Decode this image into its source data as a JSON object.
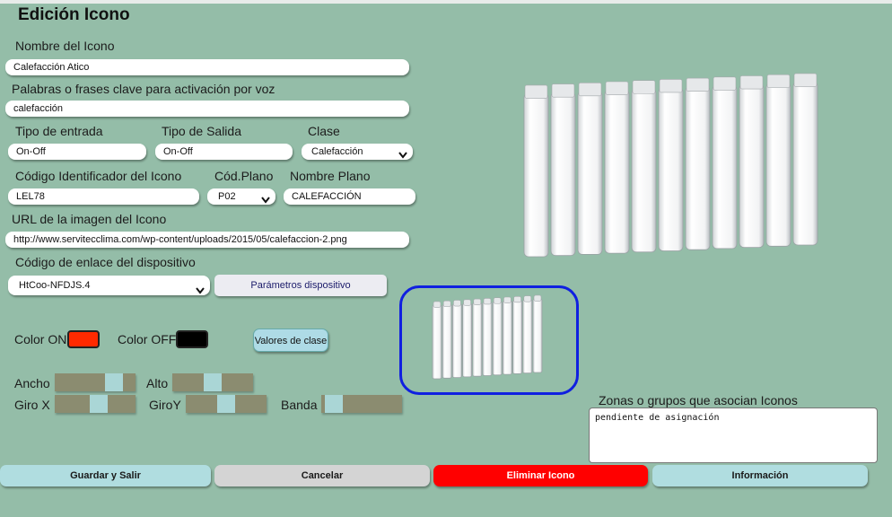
{
  "form": {
    "title": "Edición Icono",
    "name_label": "Nombre del Icono",
    "name_value": "Calefacción Atico",
    "keywords_label": "Palabras o frases clave para activación por voz",
    "keywords_value": "calefacción",
    "input_type_label": "Tipo de entrada",
    "input_type_value": "On-Off",
    "output_type_label": "Tipo de Salida",
    "output_type_value": "On-Off",
    "class_label": "Clase",
    "class_value": "Calefacción",
    "code_label": "Código Identificador del Icono",
    "code_value": "LEL78",
    "plan_code_label": "Cód.Plano",
    "plan_code_value": "P02",
    "plan_name_label": "Nombre Plano",
    "plan_name_value": "CALEFACCIÓN",
    "url_label": "URL de la imagen del Icono",
    "url_value": "http://www.servitecclima.com/wp-content/uploads/2015/05/calefaccion-2.png",
    "link_label": "Código de enlace del dispositivo",
    "link_value": "HtCoo-NFDJS.4",
    "device_params_button": "Parámetros dispositivo",
    "color_on_label": "Color ON",
    "color_on": "#ff2a00",
    "color_off_label": "Color OFF",
    "color_off": "#000000",
    "class_values_button": "Valores de clase",
    "width_label": "Ancho",
    "height_label": "Alto",
    "rot_x_label": "Giro X",
    "rot_y_label": "GiroY",
    "band_label": "Banda",
    "zones_label": "Zonas o grupos que asocian Iconos",
    "zones_value": "pendiente de asignación"
  },
  "sliders": {
    "width_level": 0.8,
    "height_level": 0.5,
    "rot_x_level": 0.55,
    "rot_y_level": 0.5,
    "band_level": 0.05
  },
  "buttons": {
    "save": "Guardar y Salir",
    "cancel": "Cancelar",
    "delete": "Eliminar Icono",
    "info": "Información"
  },
  "icons": {
    "large_image": "radiator-icon",
    "preview_image": "radiator-preview-icon",
    "select_arrow": "chevron-down-icon"
  },
  "colors": {
    "background": "#94bda8",
    "delete": "#ff0000",
    "save": "#b0dde0",
    "cancel": "#d4d4d4",
    "info": "#b0dde0",
    "preview_border": "#1020e0"
  }
}
